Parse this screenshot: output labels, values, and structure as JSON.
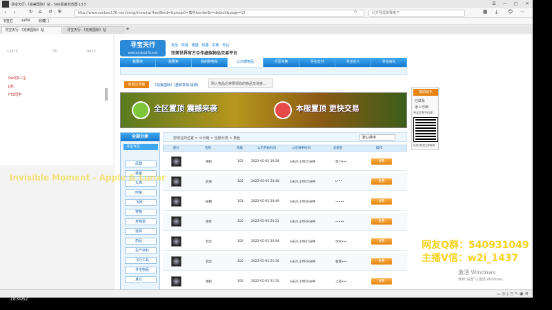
{
  "browser": {
    "title": "寻宝天行-《完美国际》站 - 360极速浏览器 13.5",
    "url": "http://www.xunbao178.com/xmgj/show.jsp?keyWord=&group0=角色&orderBy=default&page=15",
    "search_placeholder": "北方强湿单赛来了",
    "fav_items": [
      "书签栏",
      "uuPN",
      "收藏门"
    ],
    "tabs": [
      "寻宝天行-《完美国际》站",
      "寻宝天行-《完美国际》站"
    ]
  },
  "left_panel": {
    "stats": [
      "12875",
      "58",
      "9415"
    ],
    "items": [
      "QAQ梦三生",
      "JJ松",
      "FTZ同学"
    ]
  },
  "site": {
    "logo": "寻宝天行",
    "logo_sub": "www.xunbao178.com",
    "slogan": "完美世界官方合作虚拟物品交易平台",
    "tags": [
      "安全",
      "权威",
      "便捷",
      "快捷",
      "实惠",
      "专业"
    ],
    "nav": [
      "我要买",
      "我要卖",
      "我的购物车",
      "公示期物品",
      "乐豆兑换",
      "寻宝支付",
      "寻宝达人",
      "寻宝有礼"
    ],
    "notice_btn": "商城公告板",
    "notice_text": "《完美国际》(重新发现·极限)",
    "notice_popup": "购入物品后将要领取的物品交易金...",
    "banner_left": "全区置顶 震撼来袭",
    "banner_right": "本服置顶 更快交易",
    "sidebar_title": "全部分类",
    "sidebar_sub": "寻宝专区",
    "sidebar_items": [
      "武器",
      "装备",
      "头饰",
      "时装",
      "飞骑",
      "宠物",
      "宠物蛋",
      "道具",
      "药品",
      "生产材料",
      "飞行工具",
      "寻宝物品",
      "其它"
    ],
    "crumb": "您现在的位置 > 公示期 > 全部分类 > 角色",
    "sort": "默认排序",
    "columns": [
      "图片",
      "名称",
      "等级",
      "公示开始时间",
      "公示剩余时间",
      "卖家名",
      "操作"
    ],
    "rows": [
      {
        "name": "弹机",
        "level": "102",
        "start": "2022-05-05 19:28",
        "remain": "4天21小时25分钟",
        "seller": "星门•••",
        "action": "查看"
      },
      {
        "name": "武侠",
        "level": "105",
        "start": "2022-05-05 20:48",
        "remain": "4天21小时45分钟",
        "seller": "ʟ•••",
        "action": "查看"
      },
      {
        "name": "妖精",
        "level": "101",
        "start": "2022-05-05 20:49",
        "remain": "4天21小时46分钟",
        "seller": "一•••",
        "action": "查看"
      },
      {
        "name": "弹星",
        "level": "100",
        "start": "2022-05-05 20:21",
        "remain": "4天21小时46分钟",
        "seller": "一•••",
        "action": "查看"
      },
      {
        "name": "羽灵",
        "level": "100",
        "start": "2022-05-05 20:44",
        "remain": "4天21小时47分钟",
        "seller": "尔文•••",
        "action": "查看"
      },
      {
        "name": "羽灵",
        "level": "100",
        "start": "2022-05-05 21:30",
        "remain": "4天21小时49分钟",
        "seller": "蓉蓉•••",
        "action": "查看"
      },
      {
        "name": "弹机",
        "level": "100",
        "start": "2022-05-05 21:50",
        "remain": "4天21小时50分钟",
        "seller": "上官•••",
        "action": "查看"
      }
    ],
    "right_ad_title": "帮助助手",
    "right_ad_lines": [
      "已联系",
      "添人呼唤",
      "寻宝世界手机版"
    ],
    "right_ad_bottom": "点击扫码拍立即使用"
  },
  "overlays": {
    "watermark": "Invisible Moment - Apple & Lunar",
    "qq_group": "网友Q群：540931049",
    "anchor_wechat": "主播V信：w2i_1437",
    "activate_windows": "激活 Windows",
    "activate_sub": "转到\"设置\"以激活 Windows。",
    "bottom_id": "183462"
  },
  "colors": {
    "brand_blue": "#1479cf",
    "accent_orange": "#e6820e",
    "overlay_yellow": "#f5d21a"
  }
}
